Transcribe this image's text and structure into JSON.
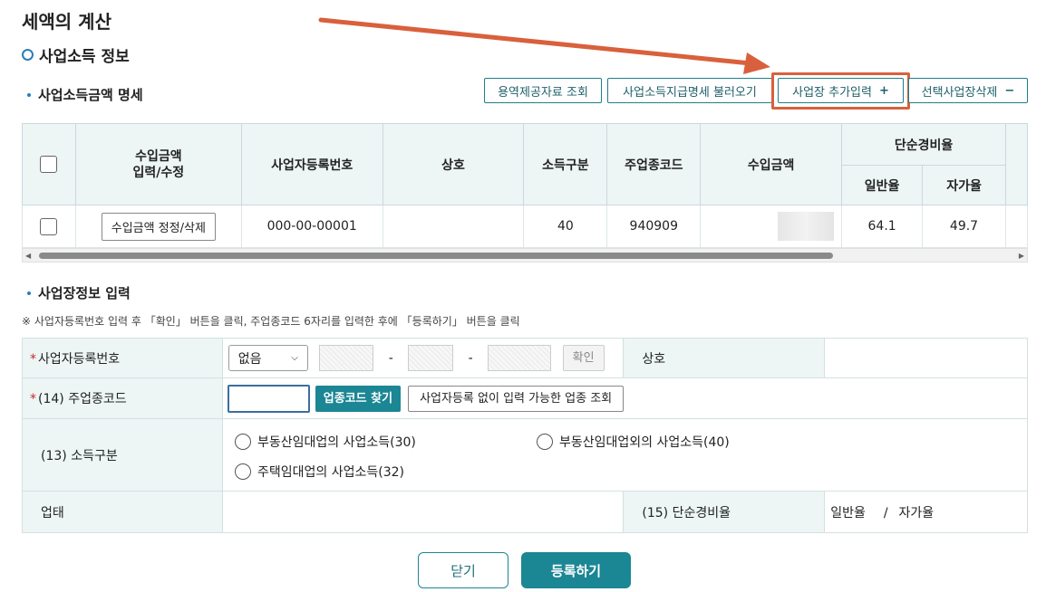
{
  "page": {
    "title": "세액의 계산"
  },
  "section": {
    "title": "사업소득 정보"
  },
  "income_detail": {
    "title": "사업소득금액 명세",
    "buttons": {
      "service_lookup": "용역제공자료 조회",
      "statement_load": "사업소득지급명세 불러오기",
      "add_business": "사업장 추가입력",
      "add_icon": "+",
      "delete_selected": "선택사업장삭제",
      "delete_icon": "−"
    },
    "columns": {
      "income_edit": "수입금액\n입력/수정",
      "reg_no": "사업자등록번호",
      "name": "상호",
      "income_type": "소득구분",
      "industry_code": "주업종코드",
      "income_amount": "수입금액",
      "simple_rate": "단순경비율",
      "general_rate": "일반율",
      "self_rate": "자가율"
    },
    "rows": [
      {
        "edit_button": "수입금액 정정/삭제",
        "reg_no": "000-00-00001",
        "name": "",
        "income_type": "40",
        "industry_code": "940909",
        "general_rate": "64.1",
        "self_rate": "49.7"
      }
    ]
  },
  "business_input": {
    "title": "사업장정보 입력",
    "notice": "※ 사업자등록번호 입력 후 「확인」 버튼을 클릭, 주업종코드 6자리를 입력한 후에 「등록하기」 버튼을 클릭",
    "reg_no_label": "사업자등록번호",
    "reg_select_value": "없음",
    "separator": "-",
    "confirm_button": "확인",
    "name_label": "상호",
    "industry_label": "(14) 주업종코드",
    "industry_search_button": "업종코드 찾기",
    "industry_lookup_button": "사업자등록 없이 입력 가능한 업종 조회",
    "income_type_label": "(13) 소득구분",
    "income_type_options": [
      "부동산임대업의 사업소득(30)",
      "부동산임대업외의 사업소득(40)",
      "주택임대업의 사업소득(32)"
    ],
    "business_type_label": "업태",
    "simple_rate_label": "(15) 단순경비율",
    "general_rate_label": "일반율",
    "slash": "/",
    "self_rate_label": "자가율",
    "required_mark": "*"
  },
  "footer": {
    "close_button": "닫기",
    "register_button": "등록하기"
  },
  "colors": {
    "accent": "#1b8694",
    "highlight": "#d9603c",
    "header_bg": "#edf5f5",
    "section_icon": "#2a7fb8"
  }
}
